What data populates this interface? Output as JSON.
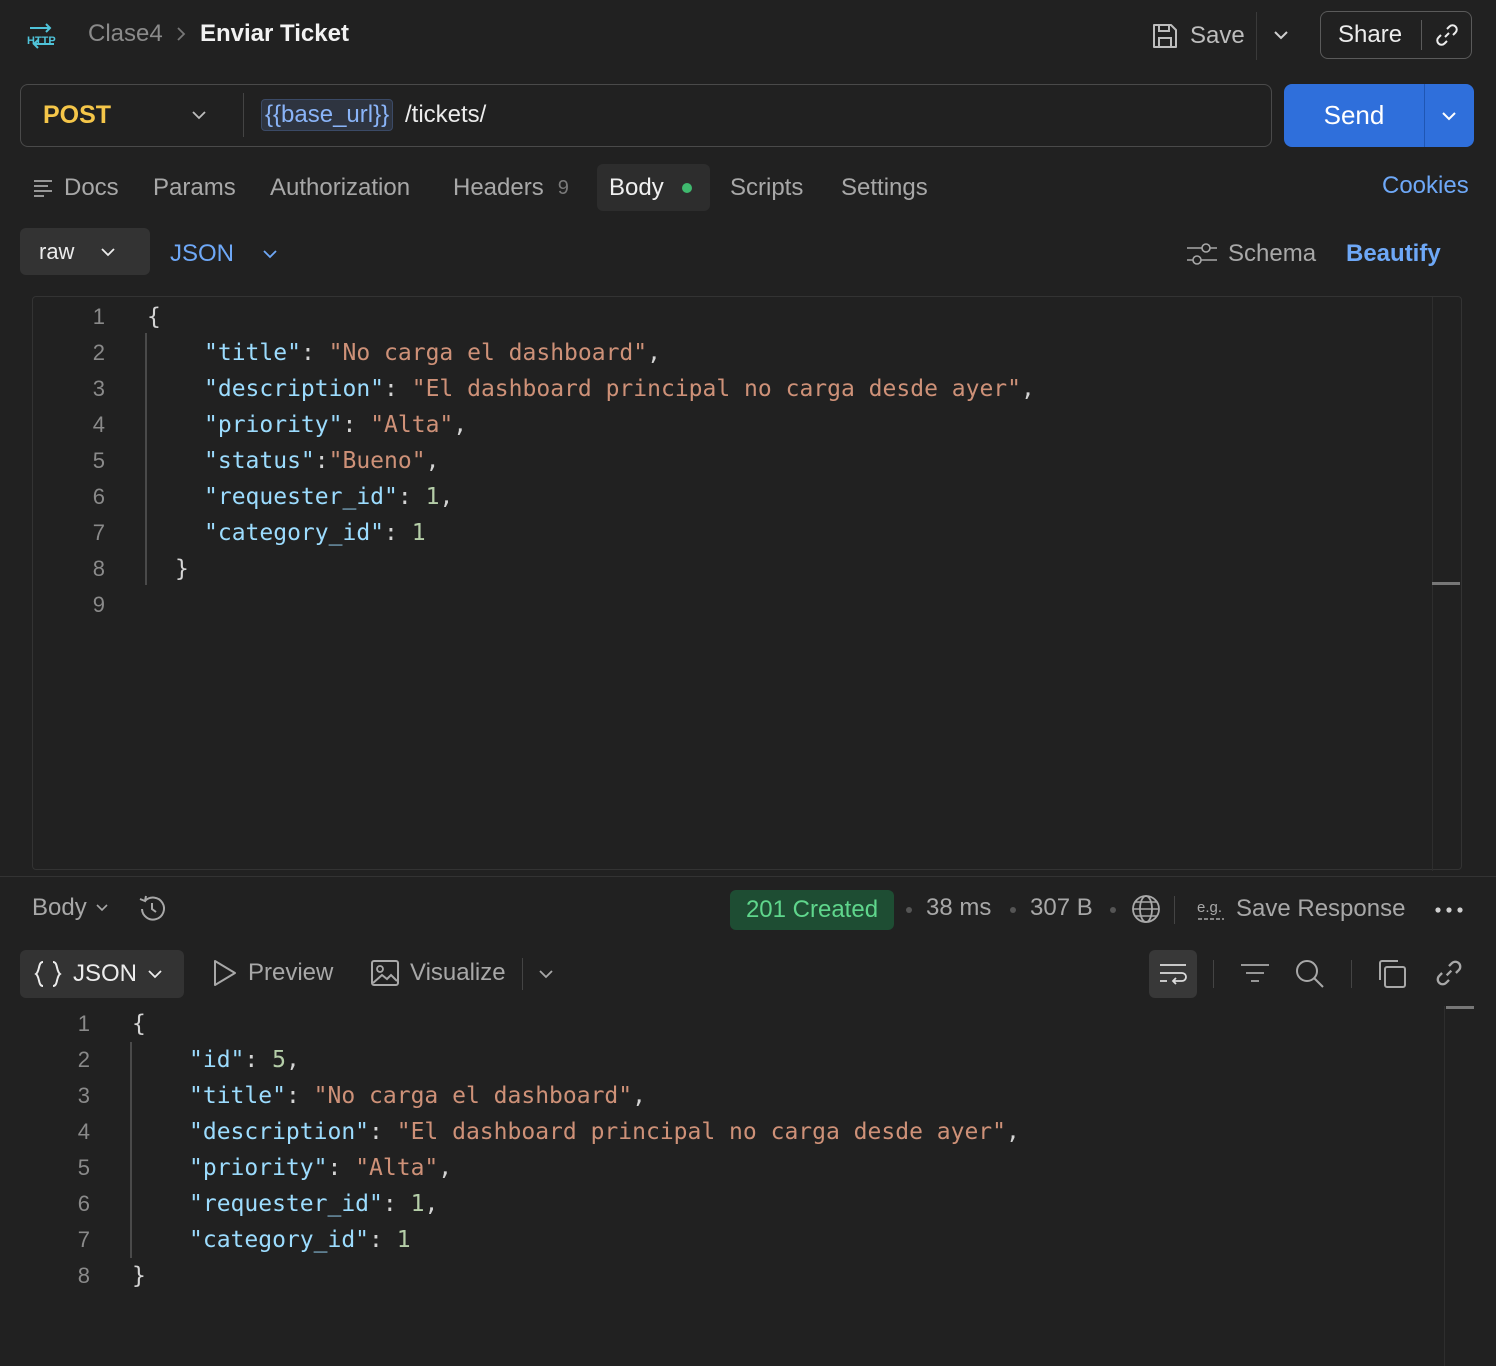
{
  "header": {
    "icon_label": "HTTP",
    "breadcrumb_parent": "Clase4",
    "title": "Enviar Ticket",
    "save_label": "Save",
    "share_label": "Share"
  },
  "request": {
    "method": "POST",
    "url_variable": "{{base_url}}",
    "url_path": "/tickets/",
    "send_label": "Send"
  },
  "tabs": [
    {
      "label": "Docs"
    },
    {
      "label": "Params"
    },
    {
      "label": "Authorization"
    },
    {
      "label": "Headers",
      "count": "9"
    },
    {
      "label": "Body",
      "active": true
    },
    {
      "label": "Scripts"
    },
    {
      "label": "Settings"
    }
  ],
  "cookies_label": "Cookies",
  "body_mode": {
    "type": "raw",
    "format": "JSON",
    "schema_label": "Schema",
    "beautify_label": "Beautify"
  },
  "request_body": [
    {
      "n": "1",
      "text": "{"
    },
    {
      "n": "2",
      "key": "\"title\"",
      "sep": ": ",
      "val": "\"No carga el dashboard\"",
      "vtype": "s",
      "tail": ","
    },
    {
      "n": "3",
      "key": "\"description\"",
      "sep": ": ",
      "val": "\"El dashboard principal no carga desde ayer\"",
      "vtype": "s",
      "tail": ","
    },
    {
      "n": "4",
      "key": "\"priority\"",
      "sep": ": ",
      "val": "\"Alta\"",
      "vtype": "s",
      "tail": ","
    },
    {
      "n": "5",
      "key": "\"status\"",
      "sep": ":",
      "val": "\"Bueno\"",
      "vtype": "s",
      "tail": ","
    },
    {
      "n": "6",
      "key": "\"requester_id\"",
      "sep": ": ",
      "val": "1",
      "vtype": "n",
      "tail": ","
    },
    {
      "n": "7",
      "key": "\"category_id\"",
      "sep": ": ",
      "val": "1",
      "vtype": "n",
      "tail": ""
    },
    {
      "n": "8",
      "text": "}"
    },
    {
      "n": "9",
      "text": ""
    }
  ],
  "response": {
    "body_label": "Body",
    "status": "201 Created",
    "time": "38 ms",
    "size": "307 B",
    "save_response_label": "Save Response",
    "eg_label": "e.g.",
    "format_label": "JSON",
    "preview_label": "Preview",
    "visualize_label": "Visualize",
    "lines": [
      {
        "n": "1",
        "text": "{"
      },
      {
        "n": "2",
        "key": "\"id\"",
        "sep": ": ",
        "val": "5",
        "vtype": "n",
        "tail": ","
      },
      {
        "n": "3",
        "key": "\"title\"",
        "sep": ": ",
        "val": "\"No carga el dashboard\"",
        "vtype": "s",
        "tail": ","
      },
      {
        "n": "4",
        "key": "\"description\"",
        "sep": ": ",
        "val": "\"El dashboard principal no carga desde ayer\"",
        "vtype": "s",
        "tail": ","
      },
      {
        "n": "5",
        "key": "\"priority\"",
        "sep": ": ",
        "val": "\"Alta\"",
        "vtype": "s",
        "tail": ","
      },
      {
        "n": "6",
        "key": "\"requester_id\"",
        "sep": ": ",
        "val": "1",
        "vtype": "n",
        "tail": ","
      },
      {
        "n": "7",
        "key": "\"category_id\"",
        "sep": ": ",
        "val": "1",
        "vtype": "n",
        "tail": ""
      },
      {
        "n": "8",
        "text": "}"
      }
    ]
  },
  "colors": {
    "accent": "#2f6fdb",
    "method_post": "#f5c649",
    "status_success": "#5fd68c",
    "link": "#6ea8f7"
  }
}
